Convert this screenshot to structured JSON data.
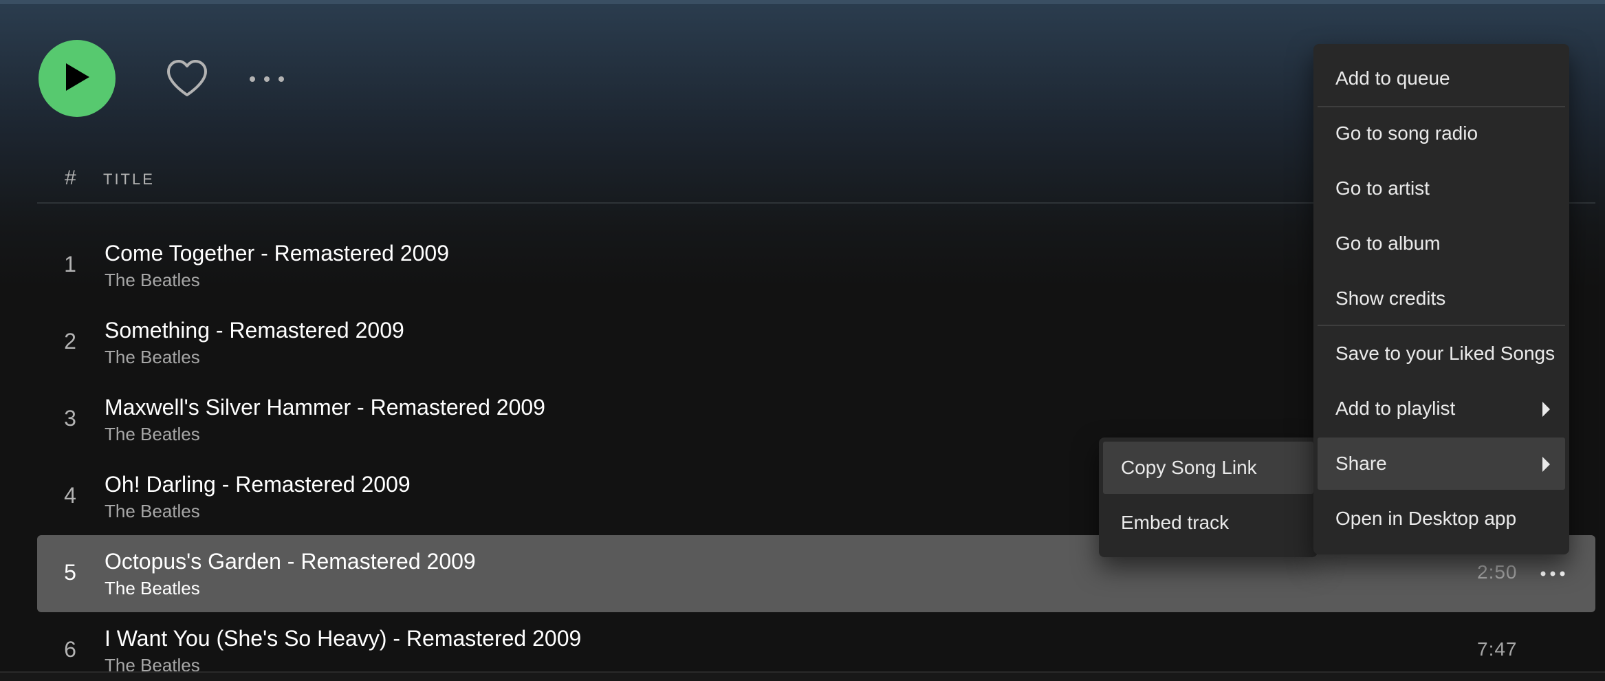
{
  "action_bar": {
    "play_icon": "play-icon",
    "heart_icon": "heart-outline-icon",
    "more_icon": "more-horizontal-icon",
    "play_color": "#57c96f"
  },
  "table_header": {
    "number_label": "#",
    "title_label": "TITLE"
  },
  "tracks": [
    {
      "number": "1",
      "title": "Come Together - Remastered 2009",
      "artist": "The Beatles",
      "duration": ""
    },
    {
      "number": "2",
      "title": "Something - Remastered 2009",
      "artist": "The Beatles",
      "duration": ""
    },
    {
      "number": "3",
      "title": "Maxwell's Silver Hammer - Remastered 2009",
      "artist": "The Beatles",
      "duration": ""
    },
    {
      "number": "4",
      "title": "Oh! Darling - Remastered 2009",
      "artist": "The Beatles",
      "duration": ""
    },
    {
      "number": "5",
      "title": "Octopus's Garden - Remastered 2009",
      "artist": "The Beatles",
      "duration": "2:50"
    },
    {
      "number": "6",
      "title": "I Want You (She's So Heavy) - Remastered 2009",
      "artist": "The Beatles",
      "duration": "7:47"
    }
  ],
  "context_menu": {
    "items": [
      {
        "label": "Add to queue"
      },
      {
        "label": "Go to song radio"
      },
      {
        "label": "Go to artist"
      },
      {
        "label": "Go to album"
      },
      {
        "label": "Show credits"
      },
      {
        "label": "Save to your Liked Songs"
      },
      {
        "label": "Add to playlist"
      },
      {
        "label": "Share"
      },
      {
        "label": "Open in Desktop app"
      }
    ]
  },
  "share_submenu": {
    "items": [
      {
        "label": "Copy Song Link"
      },
      {
        "label": "Embed track"
      }
    ]
  }
}
